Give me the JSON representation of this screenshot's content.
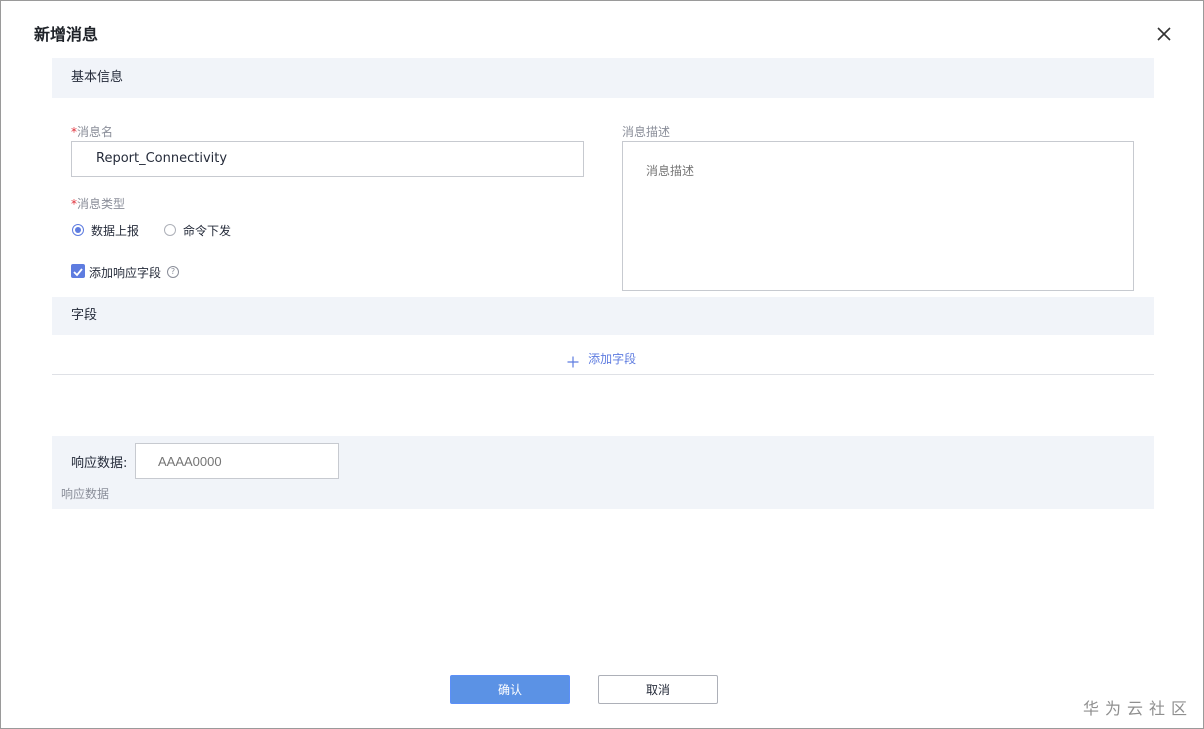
{
  "dialog": {
    "title": "新增消息"
  },
  "basic_info": {
    "section_title": "基本信息",
    "message_name": {
      "required_mark": "*",
      "label": "消息名",
      "value": "Report_Connectivity"
    },
    "message_type": {
      "required_mark": "*",
      "label": "消息类型",
      "options": [
        "数据上报",
        "命令下发"
      ],
      "selected": "数据上报"
    },
    "add_response_field": {
      "label": "添加响应字段",
      "checked": true,
      "help_icon": "question-circle-icon"
    },
    "message_description": {
      "label": "消息描述",
      "placeholder": "消息描述"
    }
  },
  "fields": {
    "section_title": "字段",
    "add_field_label": "添加字段",
    "add_icon": "plus-icon"
  },
  "response": {
    "label": "响应数据:",
    "placeholder": "AAAA0000",
    "hint": "响应数据"
  },
  "footer": {
    "confirm_label": "确认",
    "cancel_label": "取消"
  },
  "watermark": "华为云社区",
  "colors": {
    "primary": "#5b92e5",
    "section_bg": "#f1f4f9",
    "link": "#5e7ce0",
    "required": "#e0303a"
  }
}
